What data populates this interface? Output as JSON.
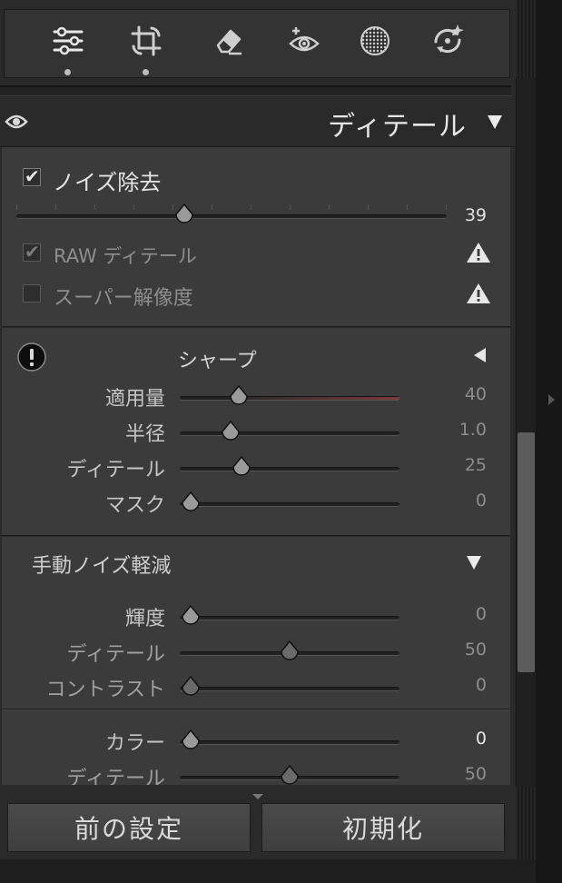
{
  "toolbar": {
    "tools": [
      {
        "icon": "sliders-icon",
        "has_dot": true
      },
      {
        "icon": "crop-rotate-icon",
        "has_dot": true
      },
      {
        "icon": "eraser-icon",
        "has_dot": false
      },
      {
        "icon": "red-eye-icon",
        "has_dot": false
      },
      {
        "icon": "masking-icon",
        "has_dot": false
      },
      {
        "icon": "presets-icon",
        "has_dot": false
      }
    ]
  },
  "detail_panel": {
    "title": "ディテール",
    "noise_removal": {
      "label": "ノイズ除去",
      "checked": true,
      "value": "39",
      "fraction": 0.39,
      "raw_detail_label": "RAW ディテール",
      "raw_detail_checked": true,
      "super_resolution_label": "スーパー解像度",
      "super_resolution_checked": false
    },
    "sharpening": {
      "title": "シャープ",
      "sliders": [
        {
          "label": "適用量",
          "value": "40",
          "fraction": 0.27
        },
        {
          "label": "半径",
          "value": "1.0",
          "fraction": 0.23
        },
        {
          "label": "ディテール",
          "value": "25",
          "fraction": 0.28
        },
        {
          "label": "マスク",
          "value": "0",
          "fraction": 0.05
        }
      ]
    },
    "manual_noise": {
      "title": "手動ノイズ軽減",
      "luminance_sliders": [
        {
          "label": "輝度",
          "value": "0",
          "fraction": 0.05
        },
        {
          "label": "ディテール",
          "value": "50",
          "fraction": 0.5
        },
        {
          "label": "コントラスト",
          "value": "0",
          "fraction": 0.05
        }
      ],
      "color_sliders": [
        {
          "label": "カラー",
          "value": "0",
          "fraction": 0.05
        },
        {
          "label": "ディテール",
          "value": "50",
          "fraction": 0.5
        }
      ]
    }
  },
  "footer": {
    "previous_label": "前の設定",
    "reset_label": "初期化"
  },
  "colors": {
    "panel_bg": "#3b3b3b",
    "amount_fill": "#7a3a3a",
    "track": "#222222"
  }
}
